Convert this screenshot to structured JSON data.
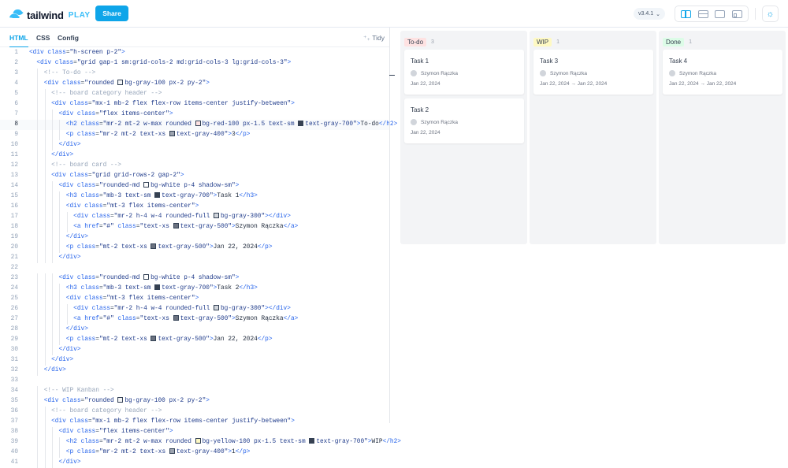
{
  "header": {
    "logo_word": "tailwind",
    "logo_play": "PLAY",
    "share": "Share",
    "version": "v3.4.1"
  },
  "editor": {
    "tabs": [
      "HTML",
      "CSS",
      "Config"
    ],
    "tidy": "Tidy",
    "current_line": 8,
    "lines": [
      "<div class=\"h-screen p-2\">",
      "  <div class=\"grid gap-1 sm:grid-cols-2 md:grid-cols-3 lg:grid-cols-3\">",
      "    <!-- To-do -->",
      "    <div class=\"rounded bg-gray-100 px-2 py-2\">",
      "      <!-- board category header -->",
      "      <div class=\"mx-1 mb-2 flex flex-row items-center justify-between\">",
      "        <div class=\"flex items-center\">",
      "          <h2 class=\"mr-2 mt-2 w-max rounded bg-red-100 px-1.5 text-sm text-gray-700\">To-do</h2>",
      "          <p class=\"mr-2 mt-2 text-xs text-gray-400\">3</p>",
      "        </div>",
      "      </div>",
      "      <!-- board card -->",
      "      <div class=\"grid grid-rows-2 gap-2\">",
      "        <div class=\"rounded-md bg-white p-4 shadow-sm\">",
      "          <h3 class=\"mb-3 text-sm text-gray-700\">Task 1</h3>",
      "          <div class=\"mt-3 flex items-center\">",
      "            <div class=\"mr-2 h-4 w-4 rounded-full bg-gray-300\"></div>",
      "            <a href=\"#\" class=\"text-xs text-gray-500\">Szymon Rączka</a>",
      "          </div>",
      "          <p class=\"mt-2 text-xs text-gray-500\">Jan 22, 2024</p>",
      "        </div>",
      "",
      "        <div class=\"rounded-md bg-white p-4 shadow-sm\">",
      "          <h3 class=\"mb-3 text-sm text-gray-700\">Task 2</h3>",
      "          <div class=\"mt-3 flex items-center\">",
      "            <div class=\"mr-2 h-4 w-4 rounded-full bg-gray-300\"></div>",
      "            <a href=\"#\" class=\"text-xs text-gray-500\">Szymon Rączka</a>",
      "          </div>",
      "          <p class=\"mt-2 text-xs text-gray-500\">Jan 22, 2024</p>",
      "        </div>",
      "      </div>",
      "    </div>",
      "",
      "    <!-- WIP Kanban -->",
      "    <div class=\"rounded bg-gray-100 px-2 py-2\">",
      "      <!-- board category header -->",
      "      <div class=\"mx-1 mb-2 flex flex-row items-center justify-between\">",
      "        <div class=\"flex items-center\">",
      "          <h2 class=\"mr-2 mt-2 w-max rounded bg-yellow-100 px-1.5 text-sm text-gray-700\">WIP</h2>",
      "          <p class=\"mr-2 mt-2 text-xs text-gray-400\">1</p>",
      "        </div>"
    ]
  },
  "preview": {
    "columns": [
      {
        "title": "To-do",
        "count": "3",
        "color": "#fee2e2",
        "cards": [
          {
            "title": "Task 1",
            "assignee": "Szymon Rączka",
            "date": "Jan 22, 2024"
          },
          {
            "title": "Task 2",
            "assignee": "Szymon Rączka",
            "date": "Jan 22, 2024"
          }
        ]
      },
      {
        "title": "WIP",
        "count": "1",
        "color": "#fef9c3",
        "cards": [
          {
            "title": "Task 3",
            "assignee": "Szymon Rączka",
            "date": "Jan 22, 2024 → Jan 22, 2024"
          }
        ]
      },
      {
        "title": "Done",
        "count": "1",
        "color": "#dcfce7",
        "cards": [
          {
            "title": "Task 4",
            "assignee": "Szymon Rączka",
            "date": "Jan 22, 2024 → Jan 22, 2024"
          }
        ]
      }
    ]
  }
}
